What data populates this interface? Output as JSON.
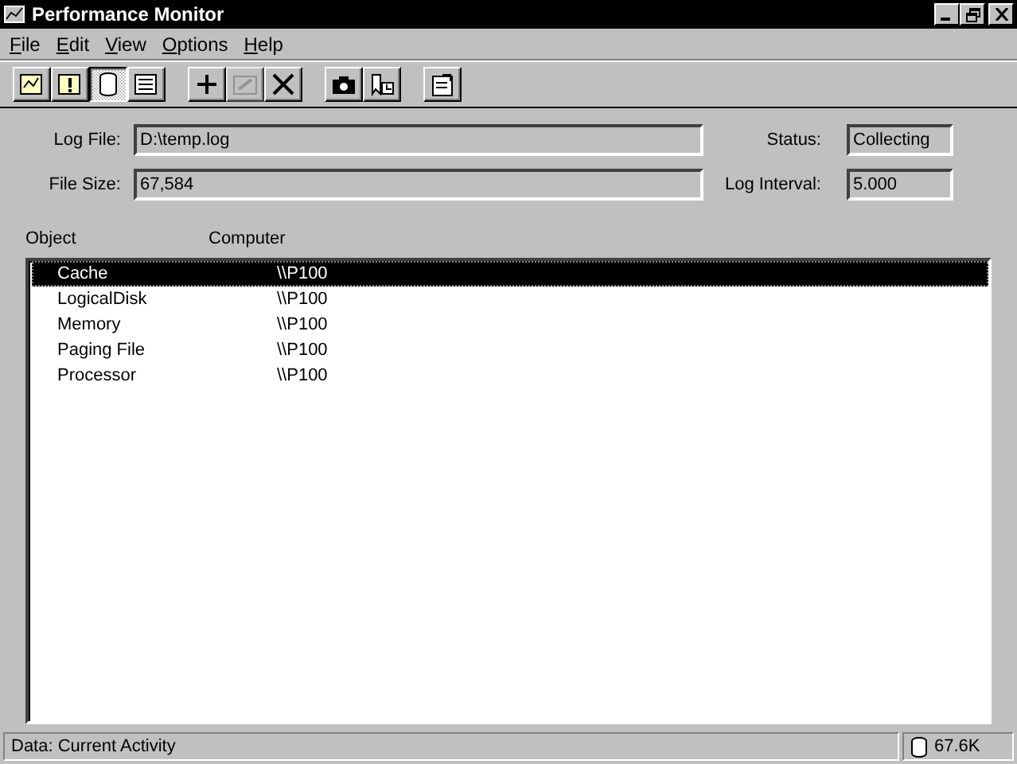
{
  "window": {
    "title": "Performance Monitor"
  },
  "menu": [
    {
      "label": "File"
    },
    {
      "label": "Edit"
    },
    {
      "label": "View"
    },
    {
      "label": "Options"
    },
    {
      "label": "Help"
    }
  ],
  "toolbar": [
    {
      "kind": "chart",
      "selected": false,
      "disabled": false
    },
    {
      "kind": "alert",
      "selected": false,
      "disabled": false
    },
    {
      "kind": "log",
      "selected": true,
      "disabled": false
    },
    {
      "kind": "report",
      "selected": false,
      "disabled": false
    },
    {
      "kind": "add",
      "selected": false,
      "disabled": false
    },
    {
      "kind": "edit",
      "selected": false,
      "disabled": true
    },
    {
      "kind": "delete",
      "selected": false,
      "disabled": false
    },
    {
      "kind": "snapshot",
      "selected": false,
      "disabled": false
    },
    {
      "kind": "bookmark",
      "selected": false,
      "disabled": false
    },
    {
      "kind": "options",
      "selected": false,
      "disabled": false
    }
  ],
  "fields": [
    {
      "label": "Log File:",
      "value": "D:\\temp.log"
    },
    {
      "label": "Status:",
      "value": "Collecting"
    },
    {
      "label": "File Size:",
      "value": "67,584"
    },
    {
      "label": "Log Interval:",
      "value": "5.000"
    }
  ],
  "table": {
    "columns": [
      "Object",
      "Computer"
    ],
    "rows": [
      {
        "object": "Cache",
        "computer": "\\\\P100",
        "selected": true
      },
      {
        "object": "LogicalDisk",
        "computer": "\\\\P100",
        "selected": false
      },
      {
        "object": "Memory",
        "computer": "\\\\P100",
        "selected": false
      },
      {
        "object": "Paging File",
        "computer": "\\\\P100",
        "selected": false
      },
      {
        "object": "Processor",
        "computer": "\\\\P100",
        "selected": false
      }
    ]
  },
  "status_bar": {
    "text": "Data: Current Activity",
    "size": "67.6K"
  }
}
